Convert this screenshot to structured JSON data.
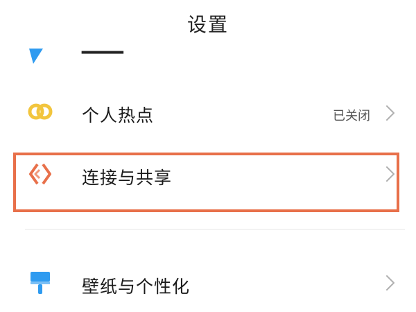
{
  "header": {
    "title": "设置"
  },
  "settings_items": [
    {
      "label": "个人热点",
      "value": "已关闭",
      "icon": "hotspot-icon",
      "icon_color": "#f2c53d"
    },
    {
      "label": "连接与共享",
      "icon": "connection-share-icon",
      "icon_color": "#e8704a",
      "highlighted": true
    },
    {
      "label": "壁纸与个性化",
      "icon": "wallpaper-brush-icon",
      "icon_color": "#2f9bf0"
    }
  ],
  "partial_item": {
    "icon": "partially-visible-icon",
    "icon_color": "#2f9bf0"
  },
  "colors": {
    "highlight_border": "#e8704a",
    "chevron": "#b0b0b0"
  }
}
